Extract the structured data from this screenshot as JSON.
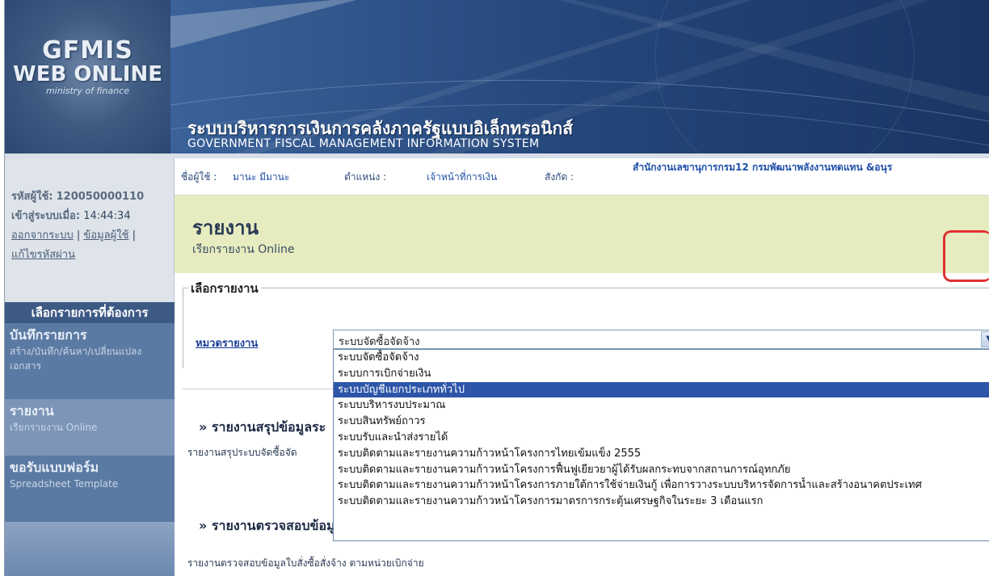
{
  "header": {
    "logo_line1": "GFMIS",
    "logo_line2": "WEB ONLINE",
    "logo_line3": "ministry of finance",
    "title_th": "ระบบบริหารการเงินการคลังภาครัฐแบบอิเล็กทรอนิกส์",
    "title_en": "GOVERNMENT FISCAL MANAGEMENT INFORMATION SYSTEM"
  },
  "sidebar": {
    "user_id_label": "รหัสผู้ใช้:",
    "user_id": "120050000110",
    "login_label": "เข้าสู่ระบบเมื่อ:",
    "login_time": "14:44:34",
    "logout_link": "ออกจากระบบ",
    "userinfo_link": "ข้อมูลผู้ใช้",
    "change_pw_link": "แก้ไขรหัสผ่าน",
    "menu_header": "เลือกรายการที่ต้องการ",
    "items": [
      {
        "title": "บันทึกรายการ",
        "sub": "สร้าง/บันทึก/ค้นหา/เปลี่ยนแปลง เอกสาร"
      },
      {
        "title": "รายงาน",
        "sub": "เรียกรายงาน Online"
      },
      {
        "title": "ขอรับแบบฟอร์ม",
        "sub": "Spreadsheet Template"
      }
    ]
  },
  "info_bar": {
    "user_label": "ชื่อผู้ใช้ :",
    "user_name": "มานะ มีมานะ",
    "position_label": "ตำแหน่ง :",
    "position": "เจ้าหน้าที่การเงิน",
    "org_label": "สังกัด :",
    "org": "สำนักงานเลขานุการกรม12 กรมพัฒนาพลังงานทดแทน &อนุร"
  },
  "page": {
    "title": "รายงาน",
    "subtitle": "เรียกรายงาน Online",
    "legend": "เลือกรายงาน",
    "category_label": "หมวดรายงาน",
    "selected_value": "ระบบจัดซื้อจัดจ้าง",
    "options": [
      "ระบบจัดซื้อจัดจ้าง",
      "ระบบการเบิกจ่ายเงิน",
      "ระบบบัญชีแยกประเภททั่วไป",
      "ระบบบริหารงบประมาณ",
      "ระบบสินทรัพย์ถาวร",
      "ระบบรับและนำส่งรายได้",
      "ระบบติดตามและรายงานความก้าวหน้าโครงการไทยเข้มแข็ง 2555",
      "ระบบติดตามและรายงานความก้าวหน้าโครงการฟื้นฟูเยียวยาผู้ได้รับผลกระทบจากสถานการณ์อุทกภัย",
      "ระบบติดตามและรายงานความก้าวหน้าโครงการภายใต้การใช้จ่ายเงินกู้ เพื่อการวางระบบบริหารจัดการน้ำและสร้างอนาคตประเทศ",
      "ระบบติดตามและรายงานความก้าวหน้าโครงการมาตรการกระตุ้นเศรษฐกิจในระยะ 3 เดือนแรก"
    ],
    "highlighted_option_index": 2,
    "section1_title": "» รายงานสรุปข้อมูลระ",
    "section1_desc": "รายงานสรุประบบจัดซื้อจัด",
    "section2_title": "» รายงานตรวจสอบข้อมู",
    "section2_desc": "รายงานตรวจสอบข้อมูลใบสั่งซื้อสั่งจ้าง ตามหน่วยเบิกจ่าย"
  },
  "colors": {
    "header_bg": "#1f3d6d",
    "sidebar_menu": "#5b7aa3",
    "page_head_bg": "#e6ecbf",
    "selected_option": "#2d55a8",
    "highlight": "#e03030"
  }
}
